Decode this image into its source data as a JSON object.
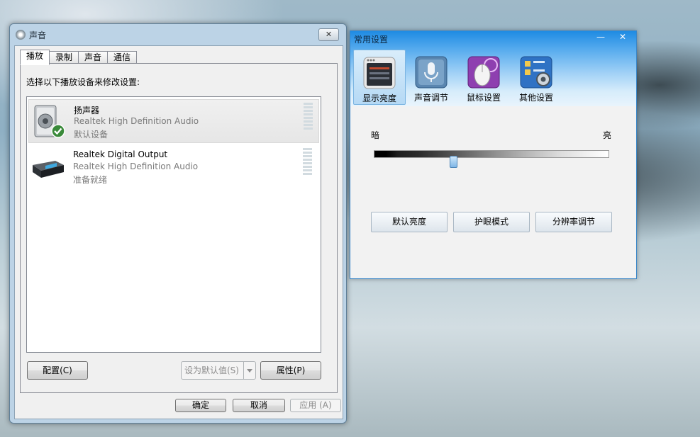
{
  "sound_dialog": {
    "title": "声音",
    "close_label": "✕",
    "tabs": [
      {
        "label": "播放",
        "active": true
      },
      {
        "label": "录制",
        "active": false
      },
      {
        "label": "声音",
        "active": false
      },
      {
        "label": "通信",
        "active": false
      }
    ],
    "instruction": "选择以下播放设备来修改设置:",
    "devices": [
      {
        "name": "扬声器",
        "driver": "Realtek High Definition Audio",
        "status": "默认设备",
        "selected": true,
        "icon": "speaker-icon"
      },
      {
        "name": "Realtek Digital Output",
        "driver": "Realtek High Definition Audio",
        "status": "准备就绪",
        "selected": false,
        "icon": "digital-output-icon"
      }
    ],
    "configure_button": "配置(C)",
    "set_default_button": "设为默认值(S)",
    "properties_button": "属性(P)",
    "ok_button": "确定",
    "cancel_button": "取消",
    "apply_button": "应用 (A)"
  },
  "common_settings": {
    "title": "常用设置",
    "minimize_label": "—",
    "close_label": "✕",
    "toolbar": [
      {
        "label": "显示亮度",
        "icon": "display-brightness-icon",
        "active": true,
        "color": "#2b2f36"
      },
      {
        "label": "声音调节",
        "icon": "microphone-icon",
        "active": false,
        "color": "#4a7aa8"
      },
      {
        "label": "鼠标设置",
        "icon": "mouse-icon",
        "active": false,
        "color": "#8e3fb0"
      },
      {
        "label": "其他设置",
        "icon": "settings-gear-icon",
        "active": false,
        "color": "#2f72c4"
      }
    ],
    "brightness": {
      "dark_label": "暗",
      "bright_label": "亮",
      "level": 0.34
    },
    "buttons": {
      "default_brightness": "默认亮度",
      "eye_protection": "护眼模式",
      "resolution": "分辨率调节"
    }
  }
}
